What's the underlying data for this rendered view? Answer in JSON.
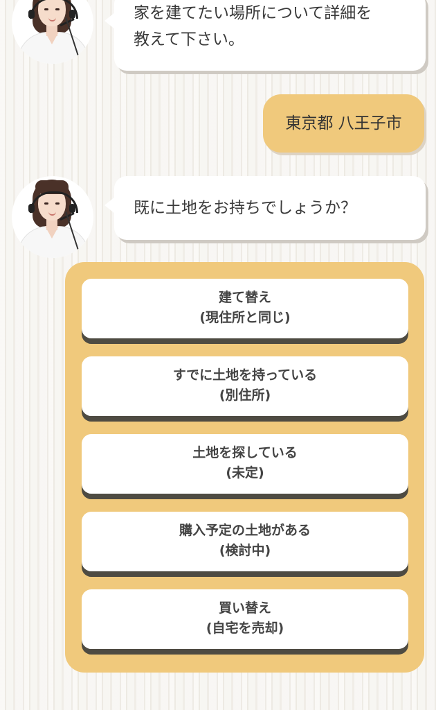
{
  "conversation": {
    "bot_message_1": {
      "line1": "家を建てたい場所について詳細を",
      "line2": "教えて下さい。"
    },
    "user_reply": "東京都 八王子市",
    "bot_message_2": "既に土地をお持ちでしょうか？"
  },
  "choices": [
    {
      "title": "建て替え",
      "subtitle": "(現住所と同じ)"
    },
    {
      "title": "すでに土地を持っている",
      "subtitle": "(別住所)"
    },
    {
      "title": "土地を探している",
      "subtitle": "(未定)"
    },
    {
      "title": "購入予定の土地がある",
      "subtitle": "(検討中)"
    },
    {
      "title": "買い替え",
      "subtitle": "(自宅を売却)"
    }
  ],
  "colors": {
    "accent": "#f0c97c",
    "bubble": "#ffffff",
    "button_shadow": "#4e4b42"
  }
}
